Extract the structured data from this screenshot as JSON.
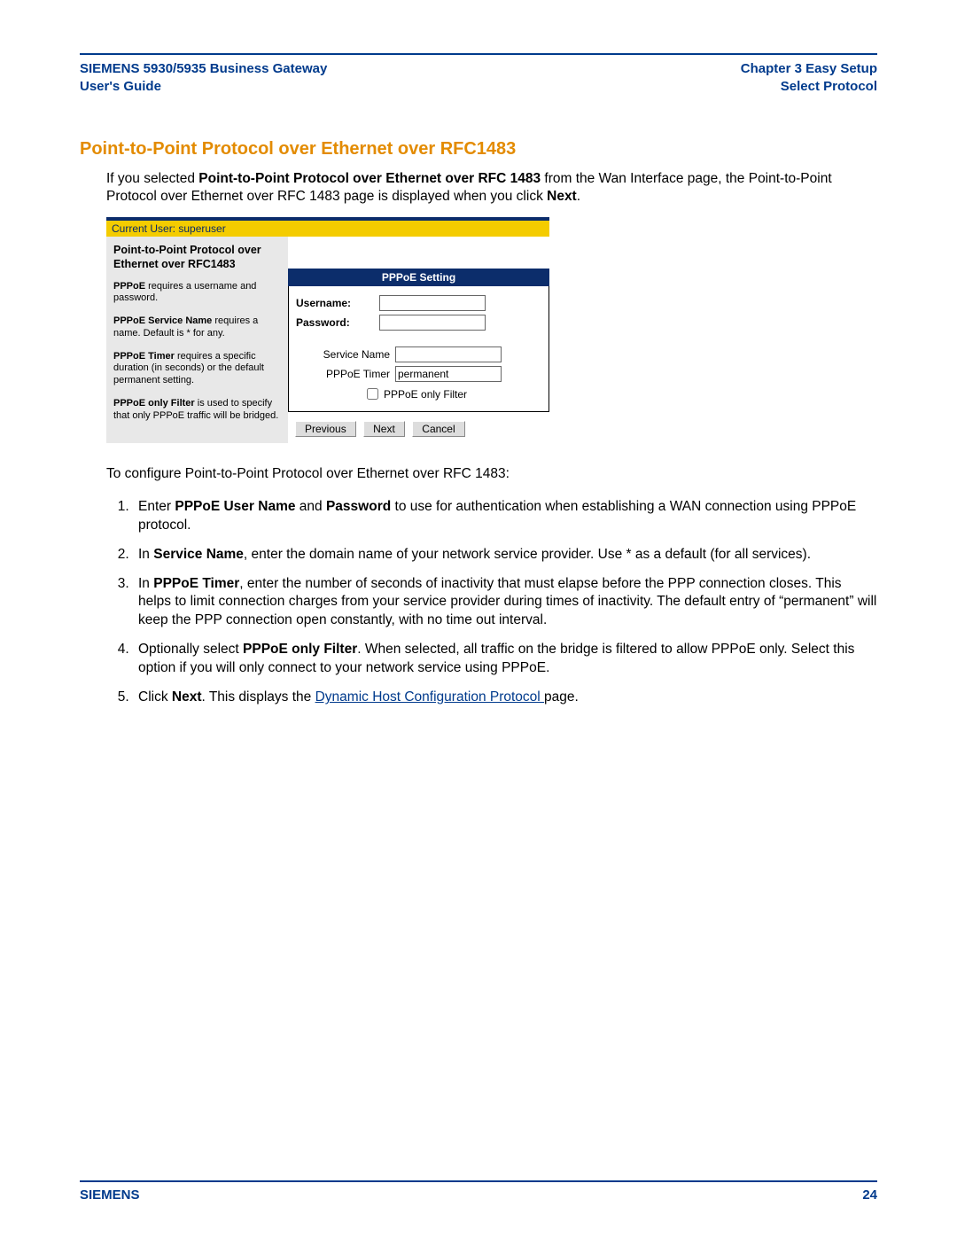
{
  "header": {
    "left1": "SIEMENS 5930/5935 Business Gateway",
    "left2": "User's Guide",
    "right1": "Chapter 3  Easy Setup",
    "right2": "Select Protocol"
  },
  "section_title": "Point-to-Point Protocol over Ethernet over RFC1483",
  "intro": {
    "pre": "If you selected ",
    "bold1": "Point-to-Point Protocol over Ethernet over RFC 1483",
    "mid": " from the Wan Interface page, the Point-to-Point Protocol over Ethernet over RFC 1483 page is displayed when you click ",
    "bold2": "Next",
    "post": "."
  },
  "embed": {
    "current_user": "Current User: superuser",
    "side_title": "Point-to-Point Protocol over Ethernet over RFC1483",
    "p1_b": "PPPoE",
    "p1_r": " requires a username and password.",
    "p2_b": "PPPoE Service Name",
    "p2_r": " requires a name. Default is * for any.",
    "p3_b": "PPPoE Timer",
    "p3_r": " requires a specific duration (in seconds) or the default permanent setting.",
    "p4_b": "PPPoE only Filter",
    "p4_r": " is used to specify that only PPPoE traffic will be bridged.",
    "panel_title": "PPPoE Setting",
    "lbl_user": "Username:",
    "lbl_pass": "Password:",
    "lbl_svc": "Service Name",
    "lbl_timer": "PPPoE Timer",
    "val_timer": "permanent",
    "lbl_filter": "PPPoE only Filter",
    "btn_prev": "Previous",
    "btn_next": "Next",
    "btn_cancel": "Cancel"
  },
  "config_intro": "To configure Point-to-Point Protocol over Ethernet over RFC 1483:",
  "steps": {
    "s1": {
      "a": "Enter ",
      "b1": "PPPoE User Name",
      "c": " and ",
      "b2": "Password",
      "d": " to use for authentication when establishing a WAN connection using PPPoE protocol."
    },
    "s2": {
      "a": "In ",
      "b": "Service Name",
      "c": ", enter the domain name of your network service provider. Use * as a default (for all services)."
    },
    "s3": {
      "a": "In ",
      "b": "PPPoE Timer",
      "c": ", enter the number of seconds of inactivity that must elapse before the PPP connection closes. This helps to limit connection charges from your service provider during times of inactivity. The default entry of “permanent” will keep the PPP connection open constantly, with no time out interval."
    },
    "s4": {
      "a": "Optionally select ",
      "b": "PPPoE only Filter",
      "c": ". When selected, all traffic on the bridge is filtered to allow PPPoE only. Select this option if you will only connect to your network service using PPPoE."
    },
    "s5": {
      "a": "Click ",
      "b": "Next",
      "c": ". This displays the ",
      "link": "Dynamic Host Configuration Protocol ",
      "d": "page."
    }
  },
  "footer": {
    "brand": "SIEMENS",
    "page": "24"
  }
}
